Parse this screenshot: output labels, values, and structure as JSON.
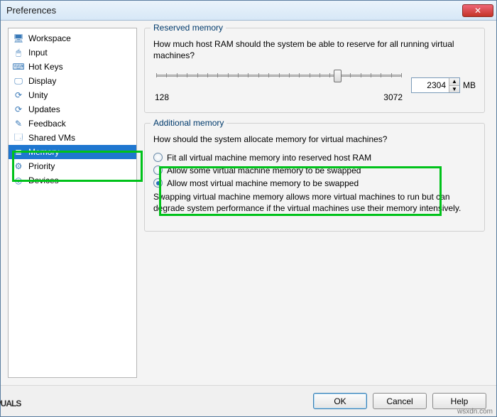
{
  "icon_glyph": {
    "workspace": "🖥",
    "input": "🖱",
    "hotkeys": "⌨",
    "display": "🖵",
    "unity": "⟳",
    "updates": "⟳",
    "feedback": "✎",
    "sharedvms": "🗔",
    "memory": "≣",
    "priority": "⚙",
    "devices": "◎"
  },
  "window": {
    "title": "Preferences"
  },
  "sidebar": {
    "items": [
      {
        "key": "workspace",
        "label": "Workspace"
      },
      {
        "key": "input",
        "label": "Input"
      },
      {
        "key": "hotkeys",
        "label": "Hot Keys"
      },
      {
        "key": "display",
        "label": "Display"
      },
      {
        "key": "unity",
        "label": "Unity"
      },
      {
        "key": "updates",
        "label": "Updates"
      },
      {
        "key": "feedback",
        "label": "Feedback"
      },
      {
        "key": "sharedvms",
        "label": "Shared VMs"
      },
      {
        "key": "memory",
        "label": "Memory"
      },
      {
        "key": "priority",
        "label": "Priority"
      },
      {
        "key": "devices",
        "label": "Devices"
      }
    ],
    "selected_key": "memory"
  },
  "reserved": {
    "group_title": "Reserved memory",
    "question": "How much host RAM should the system be able to reserve for all running virtual machines?",
    "min_label": "128",
    "max_label": "3072",
    "value": "2304",
    "unit": "MB",
    "slider_min": 128,
    "slider_max": 3072,
    "slider_value": 2304
  },
  "additional": {
    "group_title": "Additional memory",
    "question": "How should the system allocate memory for virtual machines?",
    "options": [
      {
        "label": "Fit all virtual machine memory into reserved host RAM"
      },
      {
        "label": "Allow some virtual machine memory to be swapped"
      },
      {
        "label": "Allow most virtual machine memory to be swapped"
      }
    ],
    "selected_index": 2,
    "note": "Swapping virtual machine memory allows more virtual machines to run but can degrade system performance if the virtual machines use their memory intensively."
  },
  "footer": {
    "ok": "OK",
    "cancel": "Cancel",
    "help": "Help"
  },
  "watermark": {
    "brand_left": "A",
    "brand_right": "PUALS",
    "site": "wsxdn.com"
  }
}
